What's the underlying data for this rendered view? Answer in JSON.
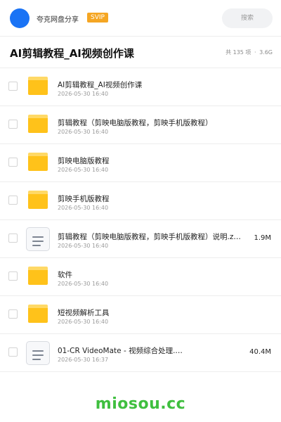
{
  "header": {
    "app_name": "夸克网盘分享",
    "badge": "SVIP",
    "search_label": "搜索"
  },
  "share": {
    "title": "AI剪辑教程_AI视频创作课",
    "count": "共 135 项",
    "separator": "·",
    "total_size": "3.6G"
  },
  "files": [
    {
      "type": "folder",
      "name": "AI剪辑教程_AI视频创作课",
      "date": "2026-05-30 16:40",
      "size": ""
    },
    {
      "type": "folder",
      "name": "剪辑教程（剪映电脑版教程，剪映手机版教程）",
      "date": "2026-05-30 16:40",
      "size": ""
    },
    {
      "type": "folder",
      "name": "剪映电脑版教程",
      "date": "2026-05-30 16:40",
      "size": ""
    },
    {
      "type": "folder",
      "name": "剪映手机版教程",
      "date": "2026-05-30 16:40",
      "size": ""
    },
    {
      "type": "file",
      "name": "剪辑教程（剪映电脑版教程，剪映手机版教程）说明.z…",
      "date": "2026-05-30 16:40",
      "size": "1.9M"
    },
    {
      "type": "folder",
      "name": "软件",
      "date": "2026-05-30 16:40",
      "size": ""
    },
    {
      "type": "folder",
      "name": "短视频解析工具",
      "date": "2026-05-30 16:40",
      "size": ""
    },
    {
      "type": "file",
      "name": "01-CR VideoMate - 视频综合处理.…",
      "date": "2026-05-30 16:37",
      "size": "40.4M"
    }
  ],
  "footer": {
    "brand": "miosou.cc"
  },
  "colors": {
    "avatar": "#1a73f5",
    "badge": "#f5a623",
    "folder": "#ffc21a",
    "brand": "#3fbf3f"
  }
}
